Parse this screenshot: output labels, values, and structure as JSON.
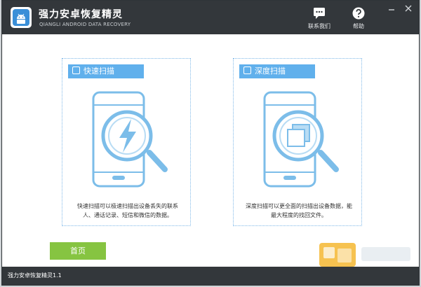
{
  "app": {
    "title": "强力安卓恢复精灵",
    "subtitle": "QIANGLI ANDROID DATA RECOVERY"
  },
  "toolbar": {
    "contact_label": "联系我们",
    "help_label": "帮助"
  },
  "cards": [
    {
      "title": "快速扫描",
      "description": "快速扫描可以极速扫描出设备丢失的联系人、通话记录、短信和微信的数据。",
      "icon": "lightning-icon"
    },
    {
      "title": "深度扫描",
      "description": "深度扫描可以更全面的扫描出设备数据，能最大程度的找回文件。",
      "icon": "stacked-files-icon"
    }
  ],
  "nav": {
    "home_label": "首页"
  },
  "status": {
    "version": "强力安卓恢复精灵1.1"
  },
  "colors": {
    "titlebar": "#33373b",
    "accent_blue": "#60b0ec",
    "home_green": "#86c441"
  }
}
